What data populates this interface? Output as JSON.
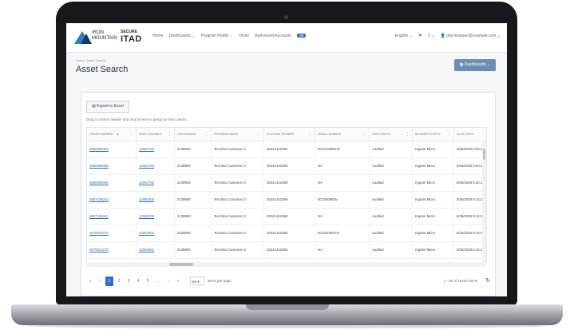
{
  "brand": {
    "line1": "IRON MOUNTAIN",
    "line2": "SECURE",
    "line3": "ITAD"
  },
  "nav": {
    "items": [
      "Home",
      "Dashboards ⌄",
      "Program Profile ⌄",
      "Order",
      "Authorized Accounts"
    ],
    "badge": "99",
    "right": [
      "English ⌄",
      "⚑",
      "1 ⌄",
      "👤 test.testuser@example.com ⌄"
    ]
  },
  "breadcrumb": "Home / Asset Search",
  "page_title": "Asset Search",
  "dashboards_button": "▦ Dashboards ⌄",
  "export_button": "Export to Excel",
  "group_hint": "Drag a column header and drop it here to group by that column",
  "columns": [
    "ORDER NUMBER",
    "ASSET NUMBER",
    "JOB NUMBER",
    "PROGRAM NAME",
    "ACCOUNT NUMBER",
    "SERIAL NUMBER",
    "ITEM STATUS",
    "BUSINESS ENTITY",
    "AUDIT DATE"
  ],
  "rows": [
    [
      "3680898490",
      "12053784",
      "2139900",
      "Test Box Customer 2",
      "0224142235K",
      "5CG7340NCR",
      "Audited",
      "Ingram Micro",
      "8/26/2020 8:20:17 PM"
    ],
    [
      "3680898490",
      "12053784",
      "2139900",
      "Test Box Customer 2",
      "0224142235K",
      "NA",
      "Audited",
      "Ingram Micro",
      "8/26/2020 8:20:17 PM"
    ],
    [
      "3680898490",
      "12053784",
      "2139900",
      "Test Box Customer 2",
      "0224142235K",
      "NA",
      "Audited",
      "Ingram Micro",
      "8/26/2020 8:20:17 PM"
    ],
    [
      "3687189341",
      "12060403",
      "2139900",
      "Test Box Customer 2",
      "0224142235K",
      "5CG6480DN",
      "Audited",
      "Ingram Micro",
      "8/26/2020 8:14:17 PM"
    ],
    [
      "3687189341",
      "12060403",
      "2139900",
      "Test Box Customer 2",
      "0224142235K",
      "NA",
      "Audited",
      "Ingram Micro",
      "8/26/2020 8:14:17 PM"
    ],
    [
      "3679322270",
      "12053501",
      "2139900",
      "Test Box Customer 2",
      "0224142235K",
      "5CG6100VFD",
      "Audited",
      "Ingram Micro",
      "8/26/2020 8:14:15 PM"
    ],
    [
      "3679322270",
      "12053501",
      "2139900",
      "Test Box Customer 2",
      "0224142235K",
      "NA",
      "Audited",
      "Ingram Micro",
      "8/26/2020 8:14:15 PM"
    ]
  ],
  "pager": {
    "first": "«",
    "prev": "‹",
    "pages": [
      "1",
      "2",
      "3",
      "4",
      "5",
      "..."
    ],
    "next": "›",
    "last": "»",
    "page_size": "50",
    "items_per_page": "items per page",
    "count": "1 - 50 of 15107 items"
  },
  "icons": {
    "refresh": "↻",
    "sort": "▲",
    "menu": "⋮",
    "export": "▤"
  },
  "colors": {
    "accent": "#2e6fd3",
    "link": "#2f6db8",
    "dash_button": "#6b8fb4"
  }
}
